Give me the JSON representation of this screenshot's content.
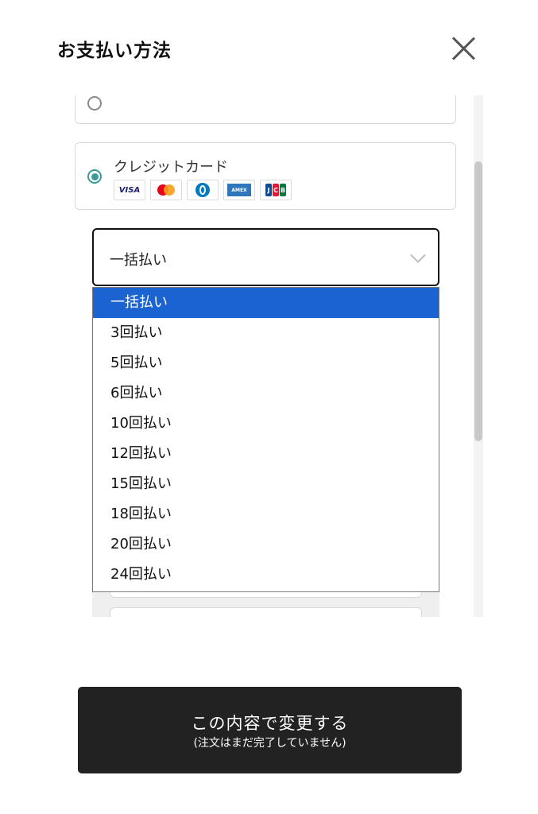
{
  "header": {
    "title": "お支払い方法"
  },
  "payment_methods": {
    "credit_card": {
      "label": "クレジットカード",
      "selected": true,
      "brands": [
        {
          "name": "VISA"
        },
        {
          "name": "Mastercard"
        },
        {
          "name": "Diners Club"
        },
        {
          "name": "AMEX"
        },
        {
          "name": "JCB"
        }
      ]
    }
  },
  "installment": {
    "selected": "一括払い",
    "options": [
      "一括払い",
      "3回払い",
      "5回払い",
      "6回払い",
      "10回払い",
      "12回払い",
      "15回払い",
      "18回払い",
      "20回払い",
      "24回払い"
    ],
    "highlighted_index": 0
  },
  "footer": {
    "confirm_label": "この内容で変更する",
    "confirm_note": "(注文はまだ完了していません)"
  },
  "colors": {
    "accent_teal": "#3c9a9a",
    "highlight_blue": "#1a63d1",
    "button_dark": "#222222"
  }
}
